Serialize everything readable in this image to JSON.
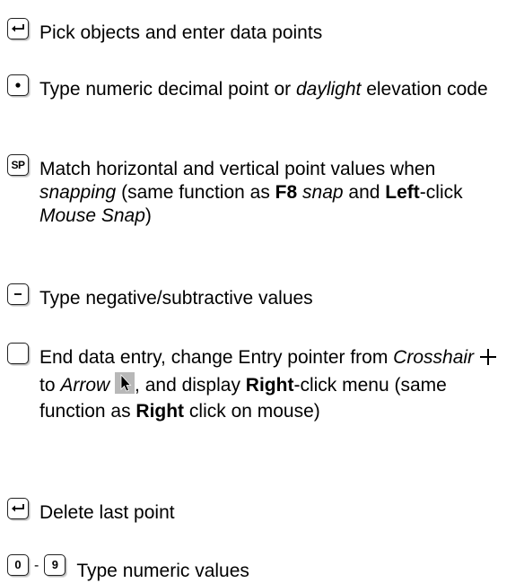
{
  "items": [
    {
      "key_icon": "enter-key-icon",
      "text": "Pick objects and enter data points"
    },
    {
      "key_icon": "period-key-icon",
      "parts": [
        "Type numeric decimal point or ",
        "daylight",
        " elevation code"
      ]
    },
    {
      "key_icon": "sp-key-icon",
      "key_label": "SP",
      "parts": [
        "Match horizontal and vertical point values when ",
        "snapping",
        " (same function as ",
        "F8",
        " ",
        "snap",
        " and ",
        "Left",
        "-click ",
        "Mouse Snap",
        ")"
      ]
    },
    {
      "key_icon": "minus-key-icon",
      "text": "Type negative/subtractive values"
    },
    {
      "key_icon": "space-key-icon",
      "parts": [
        "End data entry, change Entry pointer from ",
        "Crosshair",
        " to ",
        "Arrow",
        ", and display ",
        "Right",
        "-click menu (same function as ",
        "Right",
        " click on mouse)"
      ]
    },
    {
      "key_icon": "backspace-key-icon",
      "text": "Delete last point"
    },
    {
      "key_icons": [
        "zero-key-icon",
        "nine-key-icon"
      ],
      "key_labels": [
        "0",
        "9"
      ],
      "separator": "-",
      "text": "Type numeric values"
    }
  ]
}
